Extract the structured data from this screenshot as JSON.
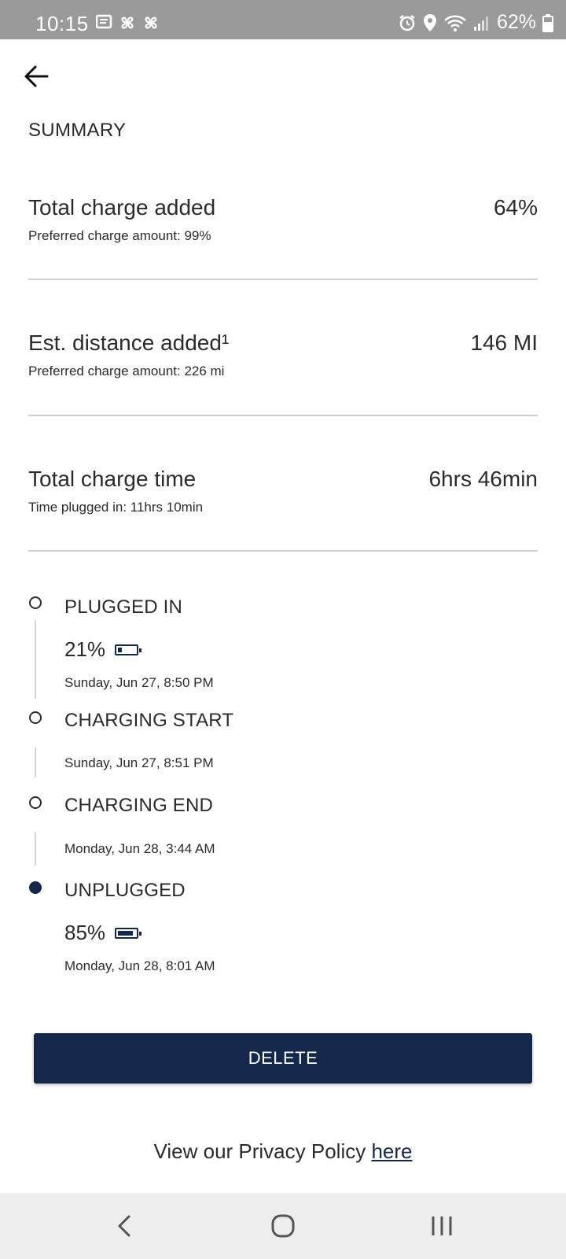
{
  "status_bar": {
    "time": "10:15",
    "battery": "62%",
    "icons_left": [
      "message-icon",
      "pinwheel-icon",
      "pinwheel-icon"
    ],
    "icons_right": [
      "alarm-icon",
      "location-icon",
      "wifi-icon",
      "signal-icon",
      "battery-icon"
    ]
  },
  "header": {
    "back_icon": "back-arrow-icon",
    "title": "SUMMARY"
  },
  "summary": [
    {
      "label": "Total charge added",
      "value": "64%",
      "sub": "Preferred charge amount: 99%"
    },
    {
      "label": "Est. distance added¹",
      "value": "146 MI",
      "sub": "Preferred charge amount: 226 mi"
    },
    {
      "label": "Total charge time",
      "value": "6hrs 46min",
      "sub": "Time plugged in: 11hrs 10min"
    }
  ],
  "timeline": [
    {
      "title": "PLUGGED IN",
      "percent": "21%",
      "battery_level": 0.21,
      "date": "Sunday, Jun 27, 8:50 PM",
      "dot": "hollow"
    },
    {
      "title": "CHARGING START",
      "date": "Sunday, Jun 27, 8:51 PM",
      "dot": "hollow"
    },
    {
      "title": "CHARGING END",
      "date": "Monday, Jun 28, 3:44 AM",
      "dot": "hollow"
    },
    {
      "title": "UNPLUGGED",
      "percent": "85%",
      "battery_level": 0.85,
      "date": "Monday, Jun 28, 8:01 AM",
      "dot": "filled"
    }
  ],
  "actions": {
    "delete_label": "DELETE"
  },
  "footer": {
    "privacy_text": "View our Privacy Policy ",
    "privacy_link": "here"
  },
  "nav_bar": {
    "icons": [
      "nav-back-icon",
      "nav-home-icon",
      "nav-recents-icon"
    ]
  },
  "colors": {
    "accent": "#14284b",
    "status_bar": "#9a9a9a",
    "divider": "#cfcfcf",
    "nav_bar": "#eeeeee"
  }
}
